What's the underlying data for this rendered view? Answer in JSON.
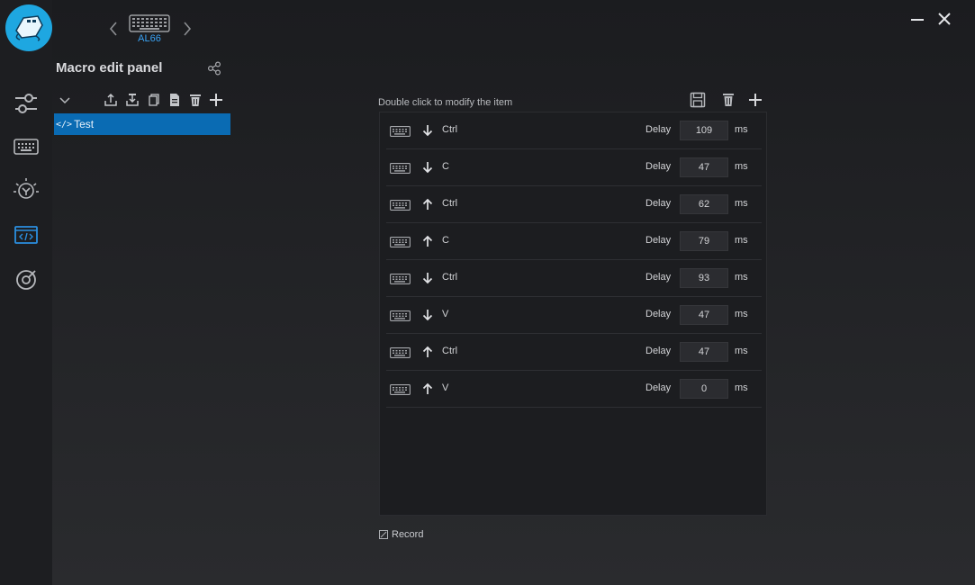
{
  "device": {
    "name": "AL66"
  },
  "panel": {
    "title": "Macro edit panel"
  },
  "macros": [
    {
      "label": "Test",
      "code_glyph": "</>"
    }
  ],
  "editor": {
    "hint": "Double click to modify the item",
    "delay_label": "Delay",
    "unit": "ms",
    "events": [
      {
        "direction": "down",
        "key": "Ctrl",
        "delay": "109"
      },
      {
        "direction": "down",
        "key": "C",
        "delay": "47"
      },
      {
        "direction": "up",
        "key": "Ctrl",
        "delay": "62"
      },
      {
        "direction": "up",
        "key": "C",
        "delay": "79"
      },
      {
        "direction": "down",
        "key": "Ctrl",
        "delay": "93"
      },
      {
        "direction": "down",
        "key": "V",
        "delay": "47"
      },
      {
        "direction": "up",
        "key": "Ctrl",
        "delay": "47"
      },
      {
        "direction": "up",
        "key": "V",
        "delay": "0"
      }
    ]
  },
  "record": {
    "label": "Record",
    "checked": false
  },
  "colors": {
    "accent": "#1ea7e1",
    "selection": "#0a6bb3",
    "highlight": "#3aa3f5"
  },
  "icons": {
    "rail": [
      "sliders-icon",
      "keyboard-icon",
      "lighting-icon",
      "macro-icon",
      "performance-icon"
    ],
    "macro_toolbar": [
      "chevron-down-icon",
      "export-icon",
      "import-icon",
      "copy-icon",
      "paste-icon",
      "delete-icon",
      "add-icon"
    ],
    "editor_toolbar": [
      "save-icon",
      "delete-icon",
      "add-icon"
    ]
  }
}
